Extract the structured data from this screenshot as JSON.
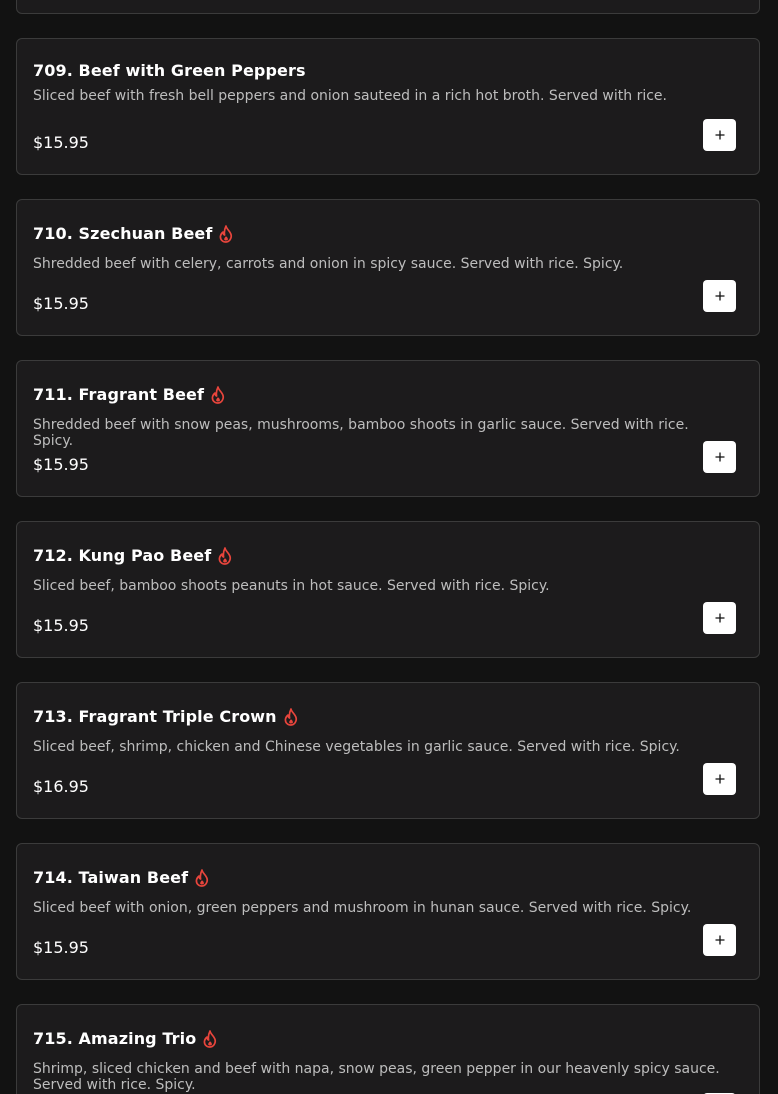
{
  "menu_items": [
    {
      "title": "709. Beef with Green Peppers",
      "description": "Sliced beef with fresh bell peppers and onion sauteed in a rich hot broth. Served with rice.",
      "price": "$15.95",
      "spicy": false
    },
    {
      "title": "710. Szechuan Beef",
      "description": "Shredded beef with celery, carrots and onion in spicy sauce. Served with rice. Spicy.",
      "price": "$15.95",
      "spicy": true
    },
    {
      "title": "711. Fragrant Beef",
      "description": "Shredded beef with snow peas, mushrooms, bamboo shoots in garlic sauce. Served with rice. Spicy.",
      "price": "$15.95",
      "spicy": true
    },
    {
      "title": "712. Kung Pao Beef",
      "description": "Sliced beef, bamboo shoots peanuts in hot sauce. Served with rice. Spicy.",
      "price": "$15.95",
      "spicy": true
    },
    {
      "title": "713. Fragrant Triple Crown",
      "description": "Sliced beef, shrimp, chicken and Chinese vegetables in garlic sauce. Served with rice. Spicy.",
      "price": "$16.95",
      "spicy": true
    },
    {
      "title": "714. Taiwan Beef",
      "description": "Sliced beef with onion, green peppers and mushroom in hunan sauce. Served with rice. Spicy.",
      "price": "$15.95",
      "spicy": true
    },
    {
      "title": "715. Amazing Trio",
      "description": "Shrimp, sliced chicken and beef with napa, snow peas, green pepper in our heavenly spicy sauce. Served with rice. Spicy.",
      "price": "",
      "spicy": true
    }
  ],
  "icons": {
    "spicy": "flame-icon",
    "add": "plus-icon"
  },
  "colors": {
    "background": "#121212",
    "card_background": "#1c1b1c",
    "card_border": "#3b3b3b",
    "spicy_icon": "#e8453c",
    "add_button": "#ffffff"
  }
}
